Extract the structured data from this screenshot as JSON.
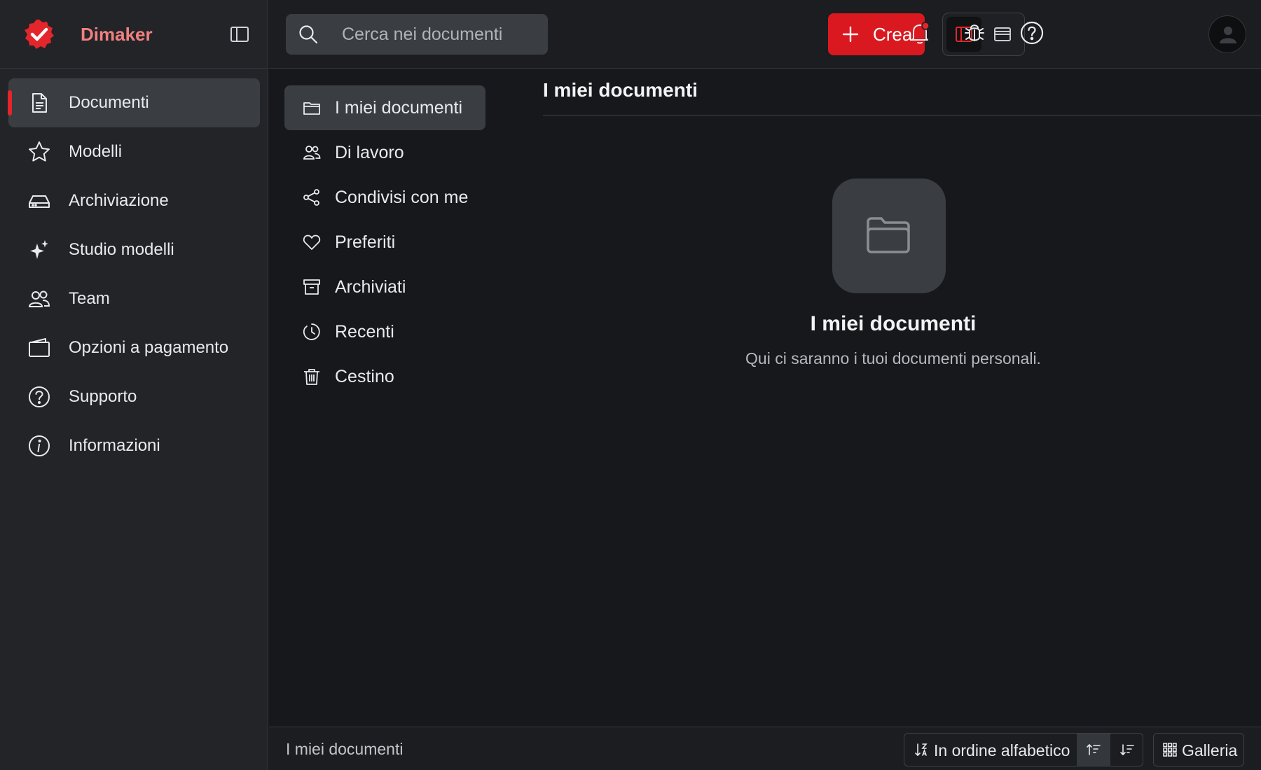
{
  "app": {
    "name": "Dimaker",
    "accent": "#d9191f",
    "brand_text_color": "#f08080"
  },
  "sidebar": {
    "items": [
      {
        "label": "Documenti",
        "icon": "document-icon",
        "active": true
      },
      {
        "label": "Modelli",
        "icon": "star-icon"
      },
      {
        "label": "Archiviazione",
        "icon": "hard-drive-icon"
      },
      {
        "label": "Studio modelli",
        "icon": "sparkle-icon"
      },
      {
        "label": "Team",
        "icon": "users-icon"
      },
      {
        "label": "Opzioni a pagamento",
        "icon": "wallet-icon"
      },
      {
        "label": "Supporto",
        "icon": "help-circle-icon"
      },
      {
        "label": "Informazioni",
        "icon": "info-icon"
      }
    ]
  },
  "topbar": {
    "search_placeholder": "Cerca nei documenti",
    "create_label": "Crea"
  },
  "subnav": {
    "items": [
      {
        "label": "I miei documenti",
        "icon": "folder-icon",
        "active": true
      },
      {
        "label": "Di lavoro",
        "icon": "users-icon"
      },
      {
        "label": "Condivisi con me",
        "icon": "share-icon"
      },
      {
        "label": "Preferiti",
        "icon": "heart-icon"
      },
      {
        "label": "Archiviati",
        "icon": "archive-icon"
      },
      {
        "label": "Recenti",
        "icon": "clock-icon"
      },
      {
        "label": "Cestino",
        "icon": "trash-icon"
      }
    ]
  },
  "main": {
    "title": "I miei documenti",
    "empty_title": "I miei documenti",
    "empty_subtitle": "Qui ci saranno i tuoi documenti personali."
  },
  "bottombar": {
    "path": "I miei documenti",
    "sort_label": "In ordine alfabetico",
    "view_label": "Galleria"
  }
}
